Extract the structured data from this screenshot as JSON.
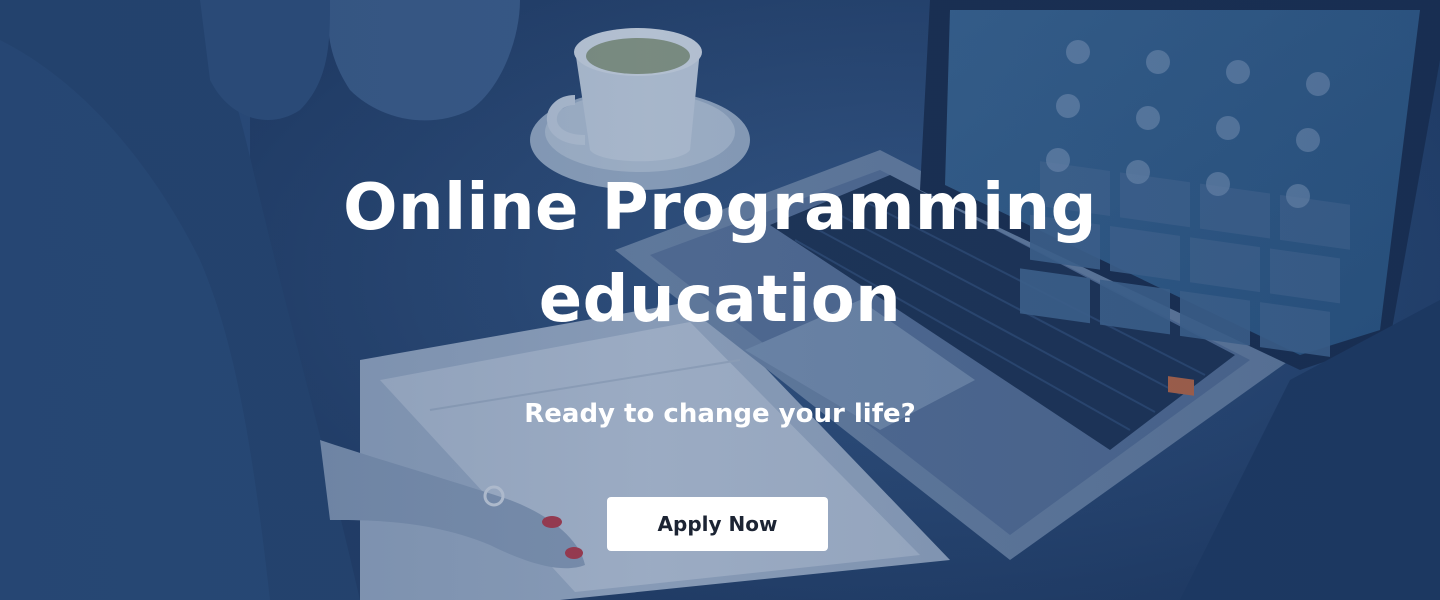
{
  "hero": {
    "title_line1": "Online Programming",
    "title_line2": "education",
    "subtitle": "Ready to change your life?",
    "cta_label": "Apply Now"
  },
  "colors": {
    "overlay": "#2d4e7c",
    "title_text": "#ffffff",
    "button_bg": "#ffffff",
    "button_text": "#1c2433"
  },
  "icons": [
    "hero-background-photo"
  ]
}
